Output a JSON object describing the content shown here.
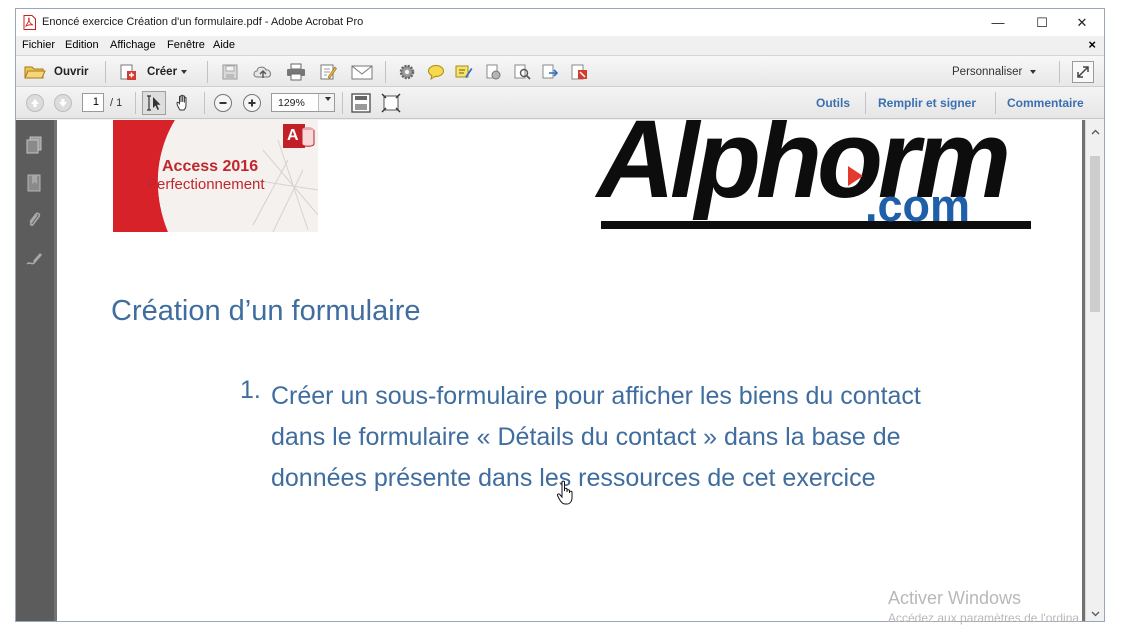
{
  "window": {
    "title": "Enoncé exercice Création d'un formulaire.pdf - Adobe Acrobat Pro",
    "minimize": "—",
    "maximize": "☐",
    "close": "✕"
  },
  "menu": {
    "items": [
      "Fichier",
      "Edition",
      "Affichage",
      "Fenêtre",
      "Aide"
    ],
    "doc_close": "×"
  },
  "toolbar1": {
    "open_label": "Ouvrir",
    "create_label": "Créer",
    "customize_label": "Personnaliser"
  },
  "toolbar2": {
    "page_current": "1",
    "page_total": "/ 1",
    "zoom": "129%",
    "links": [
      "Outils",
      "Remplir et signer",
      "Commentaire"
    ]
  },
  "document": {
    "banner_line1": "Access 2016",
    "banner_line2": "Perfectionnement",
    "access_letter": "A",
    "logo_main": "Alphorm",
    "logo_sub": ".com",
    "title": "Création d’un formulaire",
    "list_number": "1.",
    "list_lines": [
      "Créer un sous-formulaire pour afficher les biens du contact",
      "dans le formulaire « Détails du contact » dans la base de",
      "données présente dans les ressources de cet exercice"
    ]
  },
  "watermark": {
    "title": "Activer Windows",
    "subtitle": "Accédez aux paramètres de l'ordina"
  },
  "colors": {
    "text_blue": "#3f6d9f",
    "link_blue": "#3a70b0",
    "logo_blue": "#1f5ea8",
    "logo_red": "#e23b2e",
    "banner_red": "#d8222a"
  }
}
